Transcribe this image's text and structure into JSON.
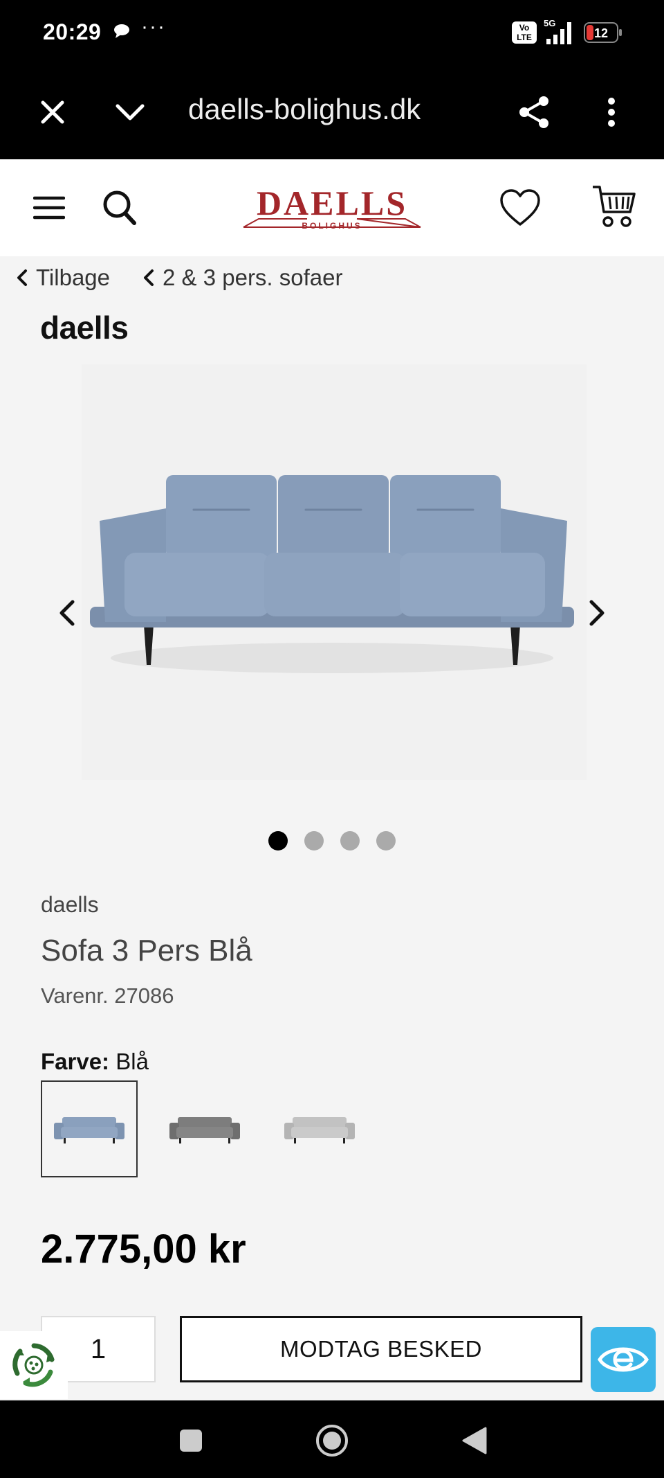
{
  "status_bar": {
    "time": "20:29",
    "more": "···",
    "volte": "Vo LTE",
    "network": "5G",
    "battery": "12"
  },
  "browser": {
    "url": "daells-bolighus.dk"
  },
  "site": {
    "logo_main": "DAELLS",
    "logo_sub": "BOLIGHUS"
  },
  "breadcrumbs": {
    "back": "Tilbage",
    "category": "2 & 3 pers. sofaer"
  },
  "brand_logo": "daells",
  "gallery": {
    "slide_count": 4,
    "active_slide": 1,
    "sofa_color": "#8a9fbd"
  },
  "product": {
    "brand": "daells",
    "title": "Sofa 3 Pers Blå",
    "sku": "Varenr. 27086",
    "color_label": "Farve:",
    "color_value": "Blå",
    "swatches": [
      {
        "name": "Blå",
        "color": "#8a9fbd",
        "selected": true
      },
      {
        "name": "Grå",
        "color": "#7a7a7a",
        "selected": false
      },
      {
        "name": "Lysegrå",
        "color": "#bdbdbd",
        "selected": false
      }
    ],
    "price": "2.775,00 kr",
    "quantity": "1",
    "notify_button": "MODTAG BESKED"
  },
  "colors": {
    "brand_red": "#a3262a",
    "emaerke_blue": "#3db6e8",
    "recycle_green": "#2e6b2f"
  }
}
